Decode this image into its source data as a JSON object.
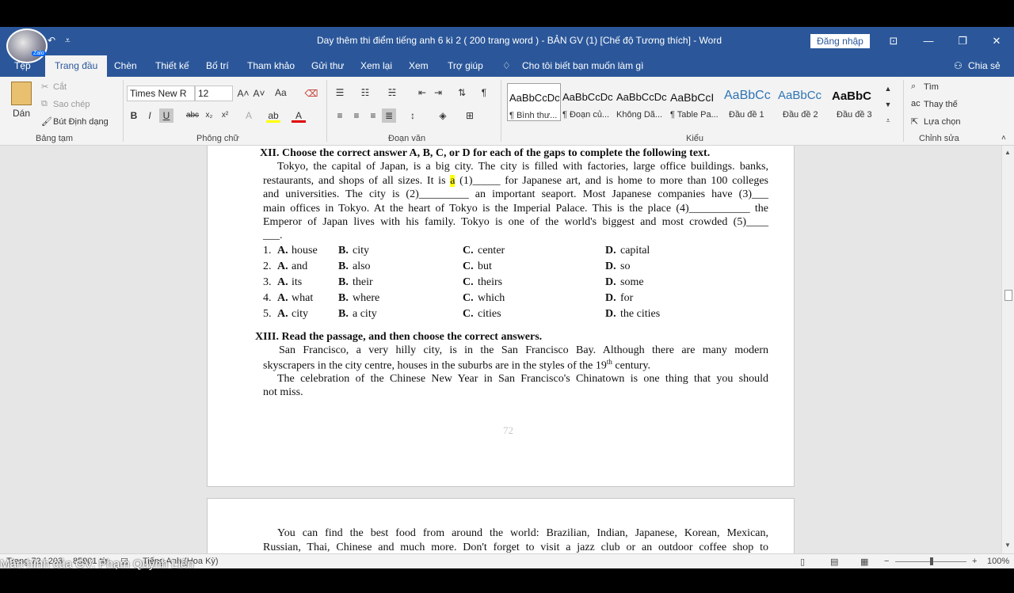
{
  "app": {
    "title": "Day thêm thi điểm tiếng anh 6 kì 2 ( 200 trang word ) - BẢN GV (1) [Chế độ Tương thích]  -  Word",
    "signin_label": "Đăng nhập",
    "avatar_badge": "Zalo",
    "overlay_caption": "Màn hình của GV: Phạm Quỳnh Liên"
  },
  "tabs": [
    {
      "label": "Tệp"
    },
    {
      "label": "Trang đầu"
    },
    {
      "label": "Chèn"
    },
    {
      "label": "Thiết kế"
    },
    {
      "label": "Bố trí"
    },
    {
      "label": "Tham khảo"
    },
    {
      "label": "Gửi thư"
    },
    {
      "label": "Xem lại"
    },
    {
      "label": "Xem"
    },
    {
      "label": "Trợ giúp"
    }
  ],
  "tell_me": "Cho tôi biết bạn muốn làm gì",
  "share_label": "Chia sẻ",
  "ribbon": {
    "clipboard": {
      "paste": "Dán",
      "cut": "Cắt",
      "copy": "Sao chép",
      "format_painter": "Bút Định dạng",
      "label": "Bảng tạm"
    },
    "font": {
      "family": "Times New R",
      "size": "12",
      "change_case": "Aa",
      "label": "Phông chữ"
    },
    "paragraph": {
      "label": "Đoạn văn"
    },
    "styles": {
      "label": "Kiểu",
      "items": [
        {
          "sample": "AaBbCcDc",
          "name": "¶ Bình thư..."
        },
        {
          "sample": "AaBbCcDc",
          "name": "¶ Đoạn củ..."
        },
        {
          "sample": "AaBbCcDc",
          "name": "Không Dã..."
        },
        {
          "sample": "AaBbCcI",
          "name": "¶ Table Pa..."
        },
        {
          "sample": "AaBbCc",
          "name": "Đầu đề 1"
        },
        {
          "sample": "AaBbCc",
          "name": "Đầu đề 2"
        },
        {
          "sample": "AaBbC",
          "name": "Đầu đề 3"
        }
      ]
    },
    "editing": {
      "find": "Tìm",
      "replace": "Thay thế",
      "select": "Lựa chọn",
      "label": "Chỉnh sửa"
    }
  },
  "document": {
    "section12_heading": "XII. Choose the correct answer A, B, C, or D for each of the gaps to complete the following text.",
    "p1_l1": "Tokyo, the capital of Japan, is a big city. The city is filled with factories, large office buildings. banks,",
    "p1_l2_a": "restaurants, and shops of all sizes. It is ",
    "p1_l2_hl": "a",
    "p1_l2_b": " (1)_____ for Japanese art, and is home to more than 100 colleges",
    "p1_l3": "and universities. The city is (2)_________ an important seaport. Most Japanese companies have (3)___",
    "p1_l4": "main offices in Tokyo. At the heart of Tokyo is the Imperial Palace. This is the place (4)___________ the",
    "p1_l5": "Emperor of Japan lives with his family. Tokyo is one of the world's biggest and most crowded (5)____",
    "p1_l6": "___.",
    "options": [
      {
        "num": "1.",
        "a": "house",
        "b": "city",
        "c": "center",
        "d": "capital"
      },
      {
        "num": "2.",
        "a": "and",
        "b": "also",
        "c": "but",
        "d": "so"
      },
      {
        "num": "3.",
        "a": "its",
        "b": "their",
        "c": "theirs",
        "d": "some"
      },
      {
        "num": "4.",
        "a": "what",
        "b": "where",
        "c": "which",
        "d": "for"
      },
      {
        "num": "5.",
        "a": "city",
        "b": "a city",
        "c": "cities",
        "d": "the cities"
      }
    ],
    "letters": {
      "a": "A.",
      "b": "B.",
      "c": "C.",
      "d": "D."
    },
    "section13_heading": "XIII. Read the passage, and then choose the correct answers.",
    "p2_l1": "San Francisco, a very hilly city, is in the San Francisco Bay. Although there are many modern",
    "p2_l2_a": "skyscrapers in the city centre, houses in the suburbs are in the styles of the 19",
    "p2_l2_sup": "th",
    "p2_l2_b": " century.",
    "p3_l1": "The celebration of the Chinese New Year in San Francisco's Chinatown is one thing that you should",
    "p3_l2": "not miss.",
    "page_number": "72",
    "p4_l1": "You can find the best food from around the world: Brazilian, Indian, Japanese, Korean, Mexican,",
    "p4_l2": "Russian, Thai, Chinese and much more. Don't forget to visit a jazz club or an outdoor coffee shop to"
  },
  "status": {
    "page": "Trang 72 / 203",
    "words": "85901 từ",
    "language": "Tiếng Anh (Hoa Kỳ)",
    "zoom": "100%"
  },
  "colors": {
    "word_blue": "#2b579a",
    "highlight": "#ffff00"
  }
}
